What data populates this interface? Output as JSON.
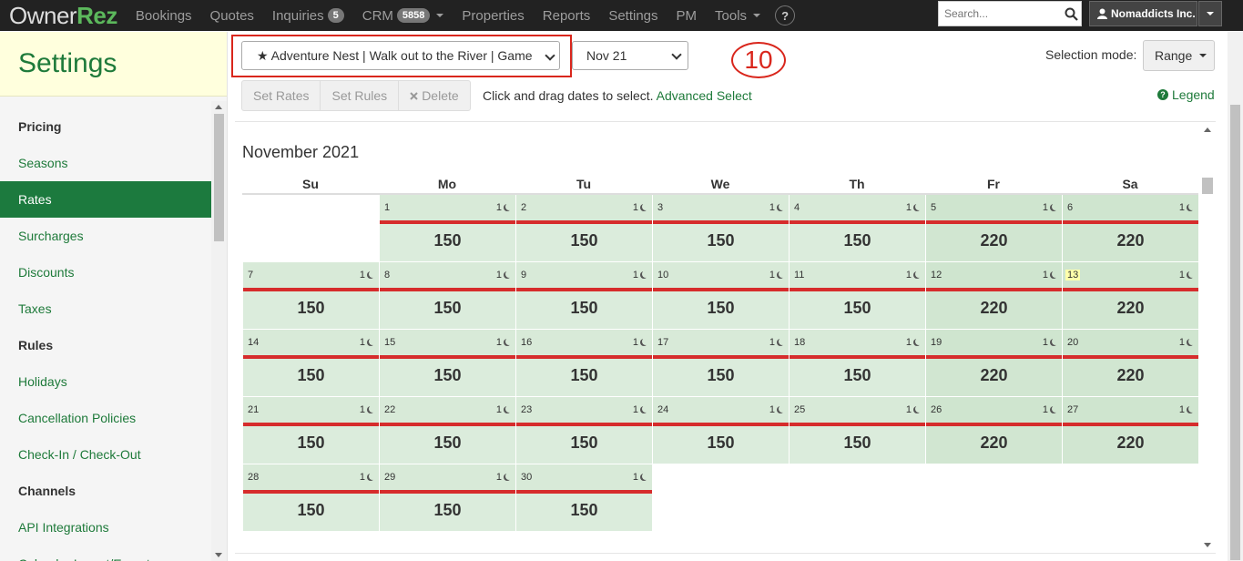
{
  "nav": {
    "logo_owner": "Owner",
    "logo_rez": "Rez",
    "items": [
      "Bookings",
      "Quotes"
    ],
    "inquiries_label": "Inquiries",
    "inquiries_count": "5",
    "crm_label": "CRM",
    "crm_count": "5858",
    "items2": [
      "Properties",
      "Reports",
      "Settings",
      "PM"
    ],
    "tools_label": "Tools",
    "help_label": "?",
    "search_placeholder": "Search...",
    "user_label": "Nomaddicts Inc."
  },
  "sidebar": {
    "title": "Settings",
    "items": [
      {
        "label": "Pricing",
        "kind": "head"
      },
      {
        "label": "Seasons",
        "kind": "link"
      },
      {
        "label": "Rates",
        "kind": "active"
      },
      {
        "label": "Surcharges",
        "kind": "link"
      },
      {
        "label": "Discounts",
        "kind": "link"
      },
      {
        "label": "Taxes",
        "kind": "link"
      },
      {
        "label": "Rules",
        "kind": "head"
      },
      {
        "label": "Holidays",
        "kind": "link"
      },
      {
        "label": "Cancellation Policies",
        "kind": "link"
      },
      {
        "label": "Check-In / Check-Out",
        "kind": "link"
      },
      {
        "label": "Channels",
        "kind": "head"
      },
      {
        "label": "API Integrations",
        "kind": "link"
      },
      {
        "label": "Calendar Import/Export",
        "kind": "link"
      }
    ]
  },
  "toolbar": {
    "property_value": "★ Adventure Nest | Walk out to the River | Game",
    "month_value": "Nov 21",
    "annotation": "10",
    "selection_mode_label": "Selection mode:",
    "selection_mode_value": "Range",
    "set_rates": "Set Rates",
    "set_rules": "Set Rules",
    "delete": "Delete",
    "hint": "Click and drag dates to select.",
    "advanced_select": "Advanced Select",
    "legend": "Legend"
  },
  "calendar": {
    "month_title": "November 2021",
    "day_headers": [
      "Su",
      "Mo",
      "Tu",
      "We",
      "Th",
      "Fr",
      "Sa"
    ],
    "first_weekday": 1,
    "min_nights": "1",
    "today": 13,
    "days": [
      {
        "d": 1,
        "rate": "150"
      },
      {
        "d": 2,
        "rate": "150"
      },
      {
        "d": 3,
        "rate": "150"
      },
      {
        "d": 4,
        "rate": "150"
      },
      {
        "d": 5,
        "rate": "220"
      },
      {
        "d": 6,
        "rate": "220"
      },
      {
        "d": 7,
        "rate": "150"
      },
      {
        "d": 8,
        "rate": "150"
      },
      {
        "d": 9,
        "rate": "150"
      },
      {
        "d": 10,
        "rate": "150"
      },
      {
        "d": 11,
        "rate": "150"
      },
      {
        "d": 12,
        "rate": "220"
      },
      {
        "d": 13,
        "rate": "220"
      },
      {
        "d": 14,
        "rate": "150"
      },
      {
        "d": 15,
        "rate": "150"
      },
      {
        "d": 16,
        "rate": "150"
      },
      {
        "d": 17,
        "rate": "150"
      },
      {
        "d": 18,
        "rate": "150"
      },
      {
        "d": 19,
        "rate": "220"
      },
      {
        "d": 20,
        "rate": "220"
      },
      {
        "d": 21,
        "rate": "150"
      },
      {
        "d": 22,
        "rate": "150"
      },
      {
        "d": 23,
        "rate": "150"
      },
      {
        "d": 24,
        "rate": "150"
      },
      {
        "d": 25,
        "rate": "150"
      },
      {
        "d": 26,
        "rate": "220"
      },
      {
        "d": 27,
        "rate": "220"
      },
      {
        "d": 28,
        "rate": "150"
      },
      {
        "d": 29,
        "rate": "150"
      },
      {
        "d": 30,
        "rate": "150"
      }
    ]
  }
}
